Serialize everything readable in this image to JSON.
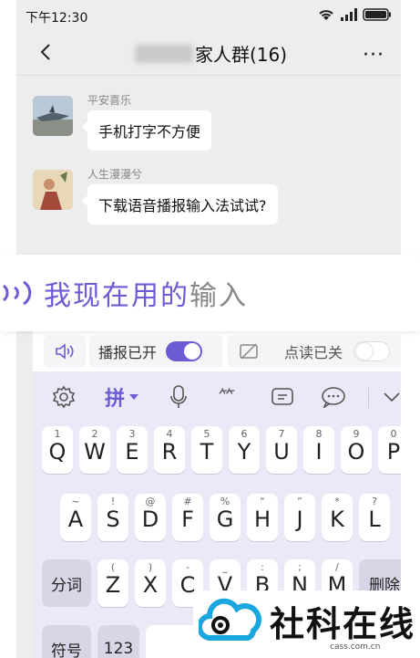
{
  "status": {
    "time": "下午12:30"
  },
  "header": {
    "title": "家人群(16)",
    "more": "···"
  },
  "messages": [
    {
      "sender": "平安喜乐",
      "text": "手机打字不方便"
    },
    {
      "sender": "人生漫漫兮",
      "text": "下载语音播报输入法试试?"
    }
  ],
  "voice_banner": {
    "highlight": "我现在用的",
    "rest": "输入"
  },
  "kb_toolbar": {
    "broadcast_label": "播报已开",
    "read_label": "点读已关"
  },
  "tools": {
    "pinyin_label": "拼"
  },
  "keys": {
    "row1": [
      {
        "h": "1",
        "k": "Q"
      },
      {
        "h": "2",
        "k": "W"
      },
      {
        "h": "3",
        "k": "E"
      },
      {
        "h": "4",
        "k": "R"
      },
      {
        "h": "5",
        "k": "T"
      },
      {
        "h": "6",
        "k": "Y"
      },
      {
        "h": "7",
        "k": "U"
      },
      {
        "h": "8",
        "k": "I"
      },
      {
        "h": "9",
        "k": "O"
      },
      {
        "h": "0",
        "k": "P"
      }
    ],
    "row2": [
      {
        "h": "~",
        "k": "A"
      },
      {
        "h": "!",
        "k": "S"
      },
      {
        "h": "@",
        "k": "D"
      },
      {
        "h": "#",
        "k": "F"
      },
      {
        "h": "%",
        "k": "G"
      },
      {
        "h": "“",
        "k": "H"
      },
      {
        "h": "”",
        "k": "J"
      },
      {
        "h": "*",
        "k": "K"
      },
      {
        "h": "?",
        "k": "L"
      }
    ],
    "row3": [
      {
        "h": "(",
        "k": "Z"
      },
      {
        "h": ")",
        "k": "X"
      },
      {
        "h": "-",
        "k": "C"
      },
      {
        "h": "_",
        "k": "V"
      },
      {
        "h": ":",
        "k": "B"
      },
      {
        "h": ";",
        "k": "N"
      },
      {
        "h": "/",
        "k": "M"
      }
    ],
    "segment_label": "分词",
    "delete_label": "删除",
    "symbol_label": "符号",
    "num_label": "123"
  },
  "watermark": {
    "text": "社科在线",
    "sub": "cass.com.cn"
  },
  "colors": {
    "accent": "#6b5cd6"
  }
}
